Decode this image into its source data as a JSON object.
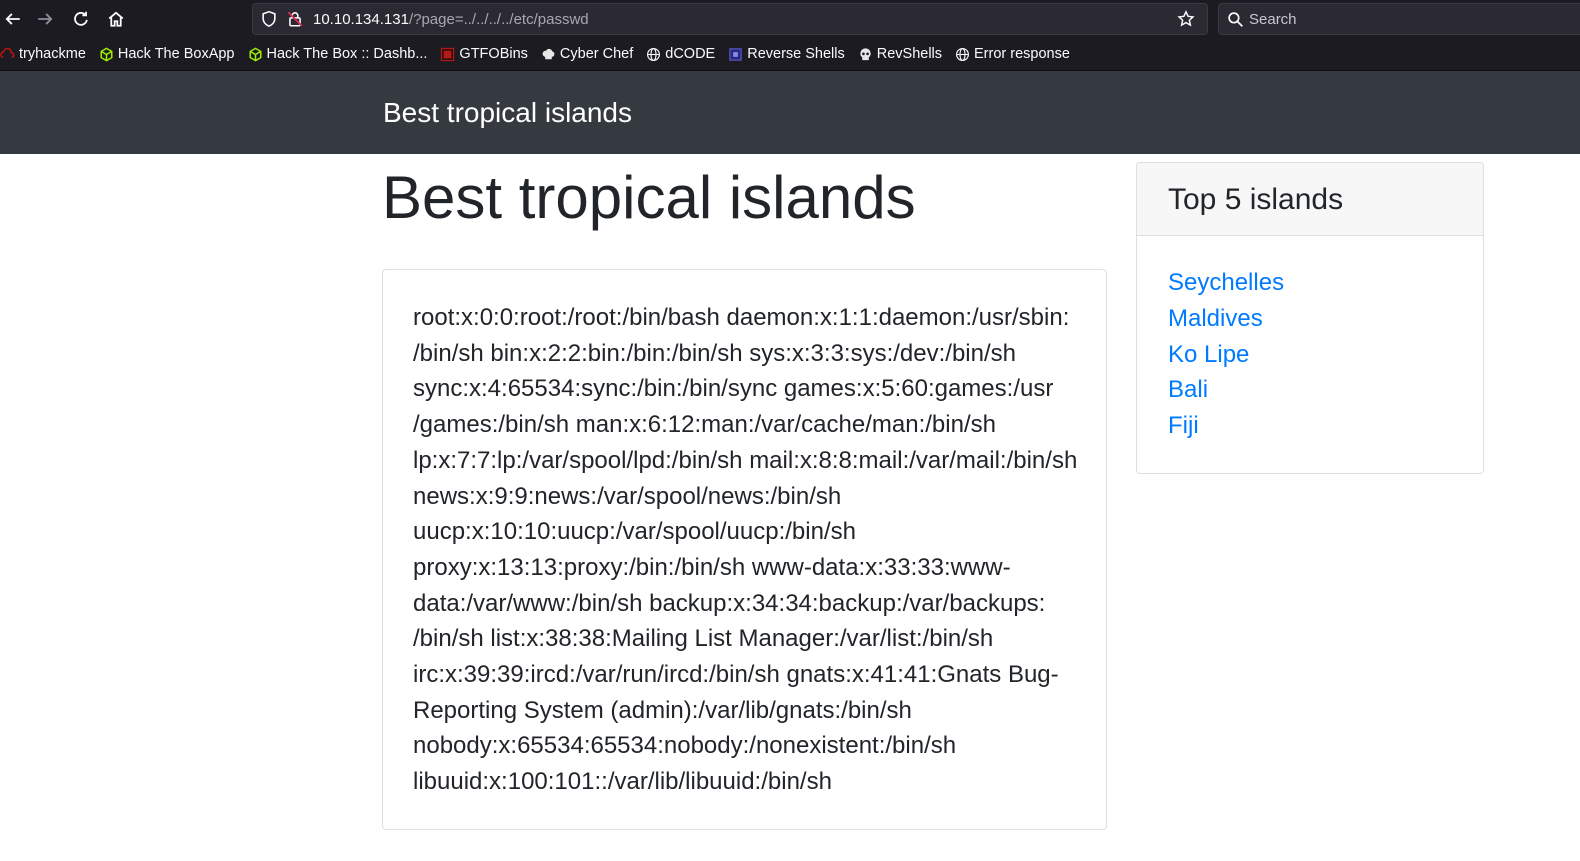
{
  "browser": {
    "url_host": "10.10.134.131",
    "url_path": "/?page=../../../../etc/passwd",
    "search_placeholder": "Search",
    "bookmarks": [
      {
        "label": "tryhackme",
        "icon": "tryhackme-icon",
        "color": "#c11111"
      },
      {
        "label": "Hack The BoxApp",
        "icon": "htb-cube-icon",
        "color": "#9fef00"
      },
      {
        "label": "Hack The Box :: Dashb...",
        "icon": "htb-cube-icon",
        "color": "#9fef00"
      },
      {
        "label": "GTFOBins",
        "icon": "gtfobins-icon",
        "color": "#b31b1b"
      },
      {
        "label": "Cyber Chef",
        "icon": "chef-hat-icon",
        "color": "#e6e6e6"
      },
      {
        "label": "dCODE",
        "icon": "globe-icon",
        "color": "#fbfbfe"
      },
      {
        "label": "Reverse Shells",
        "icon": "reverse-shells-icon",
        "color": "#5b5bd6"
      },
      {
        "label": "RevShells",
        "icon": "skull-icon",
        "color": "#e6e6e6"
      },
      {
        "label": "Error response",
        "icon": "globe-icon",
        "color": "#fbfbfe"
      }
    ]
  },
  "page": {
    "navbar_brand": "Best tropical islands",
    "heading": "Best tropical islands",
    "main_card_text": "root:x:0:0:root:/root:/bin/bash daemon:x:1:1:daemon:/usr/sbin:/bin/sh bin:x:2:2:bin:/bin:/bin/sh sys:x:3:3:sys:/dev:/bin/sh sync:x:4:65534:sync:/bin:/bin/sync games:x:5:60:games:/usr/games:/bin/sh man:x:6:12:man:/var/cache/man:/bin/sh lp:x:7:7:lp:/var/spool/lpd:/bin/sh mail:x:8:8:mail:/var/mail:/bin/sh news:x:9:9:news:/var/spool/news:/bin/sh uucp:x:10:10:uucp:/var/spool/uucp:/bin/sh proxy:x:13:13:proxy:/bin:/bin/sh www-data:x:33:33:www-data:/var/www:/bin/sh backup:x:34:34:backup:/var/backups:/bin/sh list:x:38:38:Mailing List Manager:/var/list:/bin/sh irc:x:39:39:ircd:/var/run/ircd:/bin/sh gnats:x:41:41:Gnats Bug-Reporting System (admin):/var/lib/gnats:/bin/sh nobody:x:65534:65534:nobody:/nonexistent:/bin/sh libuuid:x:100:101::/var/lib/libuuid:/bin/sh",
    "main_card_lines": [
      "root:x:0:0:root:/root:/bin/bash daemon:x:1:1:daemon:/usr/sbin:",
      "/bin/sh bin:x:2:2:bin:/bin:/bin/sh sys:x:3:3:sys:/dev:/bin/sh",
      "sync:x:4:65534:sync:/bin:/bin/sync games:x:5:60:games:/usr",
      "/games:/bin/sh man:x:6:12:man:/var/cache/man:/bin/sh",
      "lp:x:7:7:lp:/var/spool/lpd:/bin/sh mail:x:8:8:mail:/var/mail:/bin/sh",
      "news:x:9:9:news:/var/spool/news:/bin/sh",
      "uucp:x:10:10:uucp:/var/spool/uucp:/bin/sh",
      "proxy:x:13:13:proxy:/bin:/bin/sh www-data:x:33:33:www-",
      "data:/var/www:/bin/sh backup:x:34:34:backup:/var/backups:",
      "/bin/sh list:x:38:38:Mailing List Manager:/var/list:/bin/sh",
      "irc:x:39:39:ircd:/var/run/ircd:/bin/sh gnats:x:41:41:Gnats Bug-",
      "Reporting System (admin):/var/lib/gnats:/bin/sh",
      "nobody:x:65534:65534:nobody:/nonexistent:/bin/sh",
      "libuuid:x:100:101::/var/lib/libuuid:/bin/sh"
    ],
    "sidebar": {
      "title": "Top 5 islands",
      "links": [
        "Seychelles",
        "Maldives",
        "Ko Lipe",
        "Bali",
        "Fiji"
      ]
    }
  },
  "colors": {
    "navbar_bg": "#343a40",
    "link": "#007bff",
    "chrome_bg": "#1c1b22"
  }
}
